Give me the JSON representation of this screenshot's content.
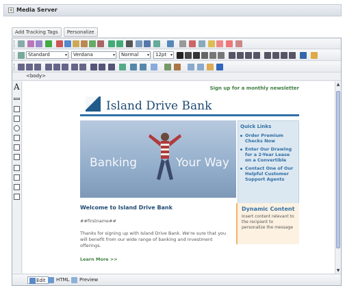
{
  "header": {
    "title": "Media Server",
    "toggle_symbol": "+"
  },
  "tracking": {
    "add_tracking_tags": "Add Tracking Tags",
    "personalize": "Personalize"
  },
  "toolbar": {
    "style": "Standard",
    "font": "Verdana",
    "size_style": "Normal",
    "font_size": "12pt"
  },
  "tagbar": {
    "tag": "<body>"
  },
  "email": {
    "newsletter_link": "Sign up for a monthly newsletter",
    "bank_name": "Island Drive Bank",
    "hero_left": "Banking",
    "hero_right": "Your Way",
    "quick_links": {
      "heading": "Quick Links",
      "items": [
        "Order Premium Checks Now",
        "Enter Our Drawing for a 2-Year Lease on a Convertible",
        "Contact One of Our Helpful Customer Support Agents"
      ]
    },
    "dynamic": {
      "heading": "Dynamic Content",
      "body": "Insert content relevant to the recipient to personalize the message"
    },
    "welcome": "Welcome to Island Drive Bank",
    "firstname": "##firstname##",
    "body": "Thanks for signing up with Island Drive Bank. We're sure that you will benefit from our wide range of banking and investment offerings.",
    "learn_more": "Learn More >>"
  },
  "modes": {
    "edit": "Edit",
    "html": "HTML",
    "preview": "Preview"
  },
  "colors": {
    "accent": "#2f6ea5",
    "green": "#3f7f41",
    "dynamic_bg": "#fdf2e2"
  }
}
